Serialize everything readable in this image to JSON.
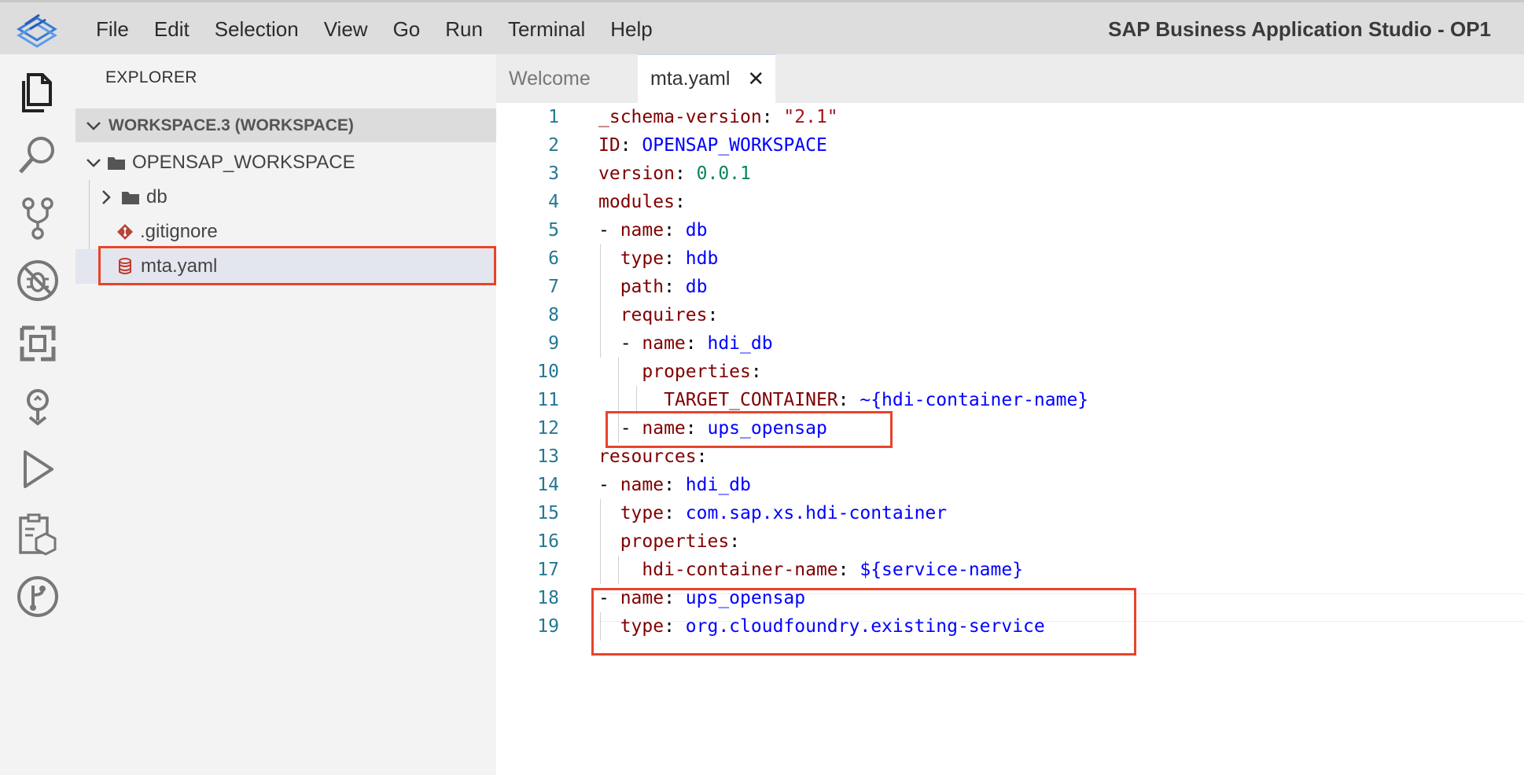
{
  "app": {
    "title": "SAP Business Application Studio - OP1",
    "menu": [
      "File",
      "Edit",
      "Selection",
      "View",
      "Go",
      "Run",
      "Terminal",
      "Help"
    ]
  },
  "activity_bar": {
    "items": [
      "files-icon",
      "search-icon",
      "source-control-icon",
      "debug-icon",
      "extensions-icon",
      "deploy-icon",
      "run-icon",
      "service-center-icon",
      "git-graph-icon"
    ]
  },
  "explorer": {
    "title": "EXPLORER",
    "workspace": "WORKSPACE.3 (WORKSPACE)",
    "project": "OPENSAP_WORKSPACE",
    "items": [
      {
        "label": "db",
        "type": "folder"
      },
      {
        "label": ".gitignore",
        "type": "git-file"
      },
      {
        "label": "mta.yaml",
        "type": "yaml-file"
      }
    ]
  },
  "tabs": [
    {
      "label": "Welcome",
      "active": false
    },
    {
      "label": "mta.yaml",
      "active": true,
      "close": "✕"
    }
  ],
  "editor": {
    "lines": [
      {
        "n": "1",
        "tokens": [
          {
            "t": "_schema-version",
            "c": "k"
          },
          {
            "t": ": ",
            "c": "p"
          },
          {
            "t": "\"2.1\"",
            "c": "s"
          }
        ]
      },
      {
        "n": "2",
        "tokens": [
          {
            "t": "ID",
            "c": "k"
          },
          {
            "t": ": ",
            "c": "p"
          },
          {
            "t": "OPENSAP_WORKSPACE",
            "c": "v"
          }
        ]
      },
      {
        "n": "3",
        "tokens": [
          {
            "t": "version",
            "c": "k"
          },
          {
            "t": ": ",
            "c": "p"
          },
          {
            "t": "0.0.1",
            "c": "n"
          }
        ]
      },
      {
        "n": "4",
        "tokens": [
          {
            "t": "modules",
            "c": "k"
          },
          {
            "t": ":",
            "c": "p"
          }
        ]
      },
      {
        "n": "5",
        "tokens": [
          {
            "t": "- ",
            "c": "p"
          },
          {
            "t": "name",
            "c": "k"
          },
          {
            "t": ": ",
            "c": "p"
          },
          {
            "t": "db",
            "c": "v"
          }
        ]
      },
      {
        "n": "6",
        "tokens": [
          {
            "t": "  ",
            "c": "p"
          },
          {
            "t": "type",
            "c": "k"
          },
          {
            "t": ": ",
            "c": "p"
          },
          {
            "t": "hdb",
            "c": "v"
          }
        ]
      },
      {
        "n": "7",
        "tokens": [
          {
            "t": "  ",
            "c": "p"
          },
          {
            "t": "path",
            "c": "k"
          },
          {
            "t": ": ",
            "c": "p"
          },
          {
            "t": "db",
            "c": "v"
          }
        ]
      },
      {
        "n": "8",
        "tokens": [
          {
            "t": "  ",
            "c": "p"
          },
          {
            "t": "requires",
            "c": "k"
          },
          {
            "t": ":",
            "c": "p"
          }
        ]
      },
      {
        "n": "9",
        "tokens": [
          {
            "t": "  - ",
            "c": "p"
          },
          {
            "t": "name",
            "c": "k"
          },
          {
            "t": ": ",
            "c": "p"
          },
          {
            "t": "hdi_db",
            "c": "v"
          }
        ]
      },
      {
        "n": "10",
        "tokens": [
          {
            "t": "    ",
            "c": "p"
          },
          {
            "t": "properties",
            "c": "k"
          },
          {
            "t": ":",
            "c": "p"
          }
        ]
      },
      {
        "n": "11",
        "tokens": [
          {
            "t": "      ",
            "c": "p"
          },
          {
            "t": "TARGET_CONTAINER",
            "c": "k"
          },
          {
            "t": ": ",
            "c": "p"
          },
          {
            "t": "~{hdi-container-name}",
            "c": "v"
          }
        ]
      },
      {
        "n": "12",
        "tokens": [
          {
            "t": "  - ",
            "c": "p"
          },
          {
            "t": "name",
            "c": "k"
          },
          {
            "t": ": ",
            "c": "p"
          },
          {
            "t": "ups_opensap",
            "c": "v"
          }
        ]
      },
      {
        "n": "13",
        "tokens": [
          {
            "t": "resources",
            "c": "k"
          },
          {
            "t": ":",
            "c": "p"
          }
        ]
      },
      {
        "n": "14",
        "tokens": [
          {
            "t": "- ",
            "c": "p"
          },
          {
            "t": "name",
            "c": "k"
          },
          {
            "t": ": ",
            "c": "p"
          },
          {
            "t": "hdi_db",
            "c": "v"
          }
        ]
      },
      {
        "n": "15",
        "tokens": [
          {
            "t": "  ",
            "c": "p"
          },
          {
            "t": "type",
            "c": "k"
          },
          {
            "t": ": ",
            "c": "p"
          },
          {
            "t": "com.sap.xs.hdi-container",
            "c": "v"
          }
        ]
      },
      {
        "n": "16",
        "tokens": [
          {
            "t": "  ",
            "c": "p"
          },
          {
            "t": "properties",
            "c": "k"
          },
          {
            "t": ":",
            "c": "p"
          }
        ]
      },
      {
        "n": "17",
        "tokens": [
          {
            "t": "    ",
            "c": "p"
          },
          {
            "t": "hdi-container-name",
            "c": "k"
          },
          {
            "t": ": ",
            "c": "p"
          },
          {
            "t": "${service-name}",
            "c": "v"
          }
        ]
      },
      {
        "n": "18",
        "tokens": [
          {
            "t": "- ",
            "c": "p"
          },
          {
            "t": "name",
            "c": "k"
          },
          {
            "t": ": ",
            "c": "p"
          },
          {
            "t": "ups_opensap",
            "c": "v"
          }
        ]
      },
      {
        "n": "19",
        "tokens": [
          {
            "t": "  ",
            "c": "p"
          },
          {
            "t": "type",
            "c": "k"
          },
          {
            "t": ": ",
            "c": "p"
          },
          {
            "t": "org.cloudfoundry.existing-service",
            "c": "v"
          }
        ]
      }
    ]
  },
  "colors": {
    "highlight": "#e8432c",
    "key": "#800000",
    "value": "#0000ff",
    "number": "#098658",
    "string": "#a31515",
    "line_number": "#237893"
  }
}
